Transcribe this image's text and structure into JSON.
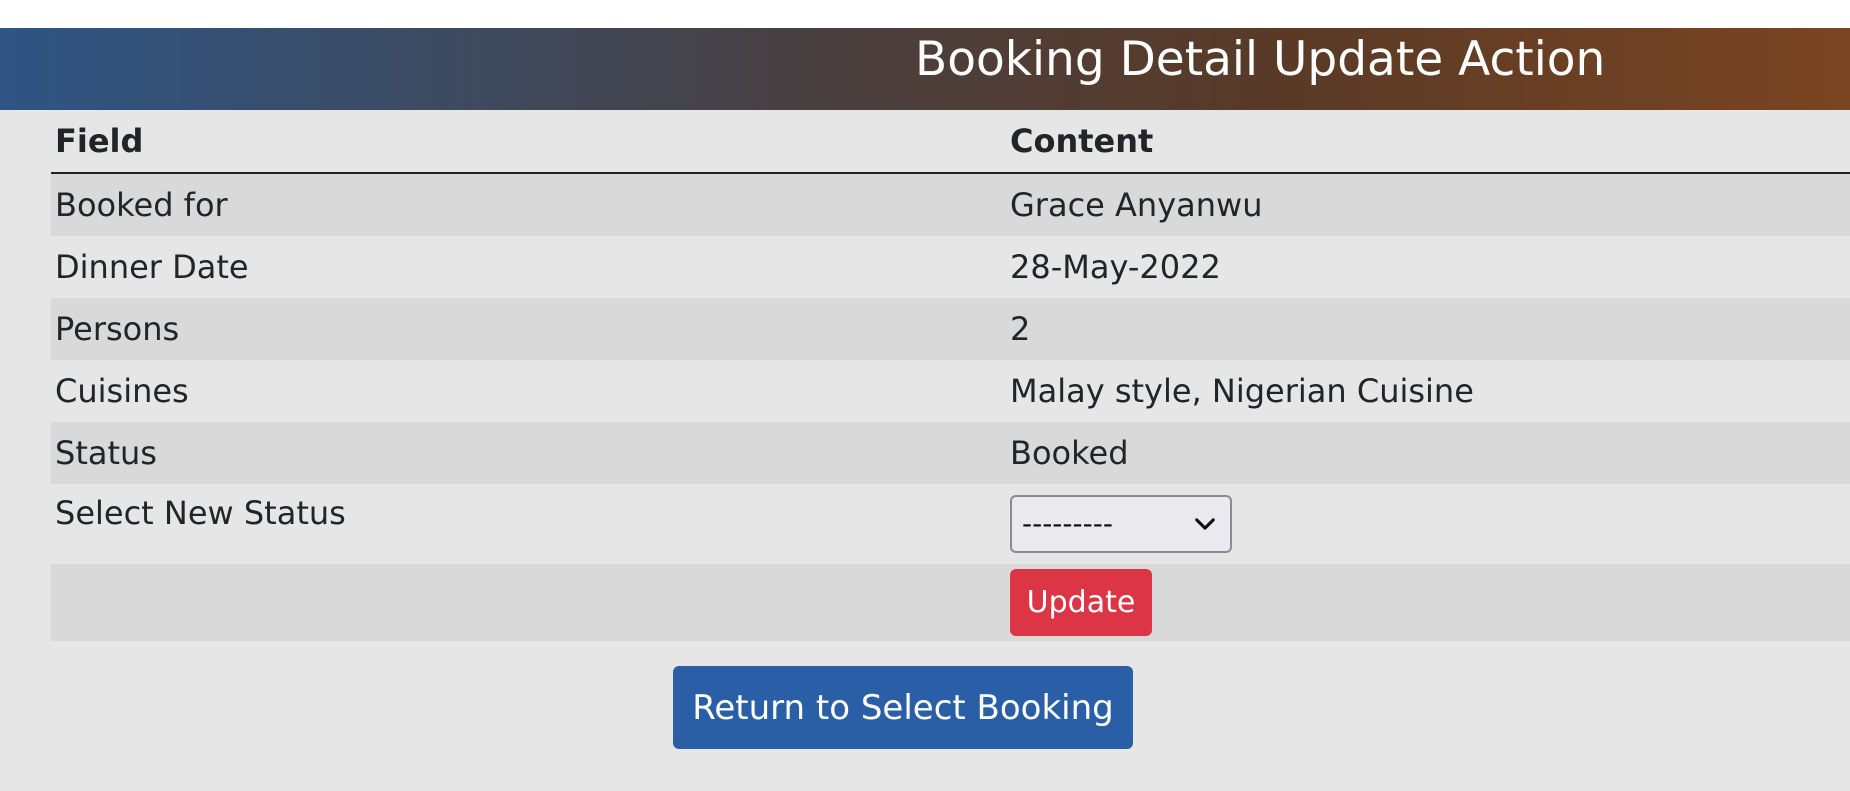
{
  "header": {
    "title": "Booking Detail Update Action"
  },
  "table": {
    "headers": {
      "field": "Field",
      "content": "Content"
    },
    "rows": [
      {
        "field": "Booked for",
        "content": "Grace Anyanwu"
      },
      {
        "field": "Dinner Date",
        "content": "28-May-2022"
      },
      {
        "field": "Persons",
        "content": "2"
      },
      {
        "field": "Cuisines",
        "content": "Malay style, Nigerian Cuisine"
      },
      {
        "field": "Status",
        "content": "Booked"
      }
    ],
    "select_row": {
      "label": "Select New Status",
      "selected_value": "---------"
    }
  },
  "actions": {
    "update_label": "Update",
    "return_label": "Return to Select Booking"
  },
  "colors": {
    "banner_start": "#2f5584",
    "banner_end": "#7a4522",
    "update_button": "#dc3545",
    "return_button": "#2a5fa8"
  },
  "icons": {
    "select_chevron": "chevron-down-icon"
  }
}
